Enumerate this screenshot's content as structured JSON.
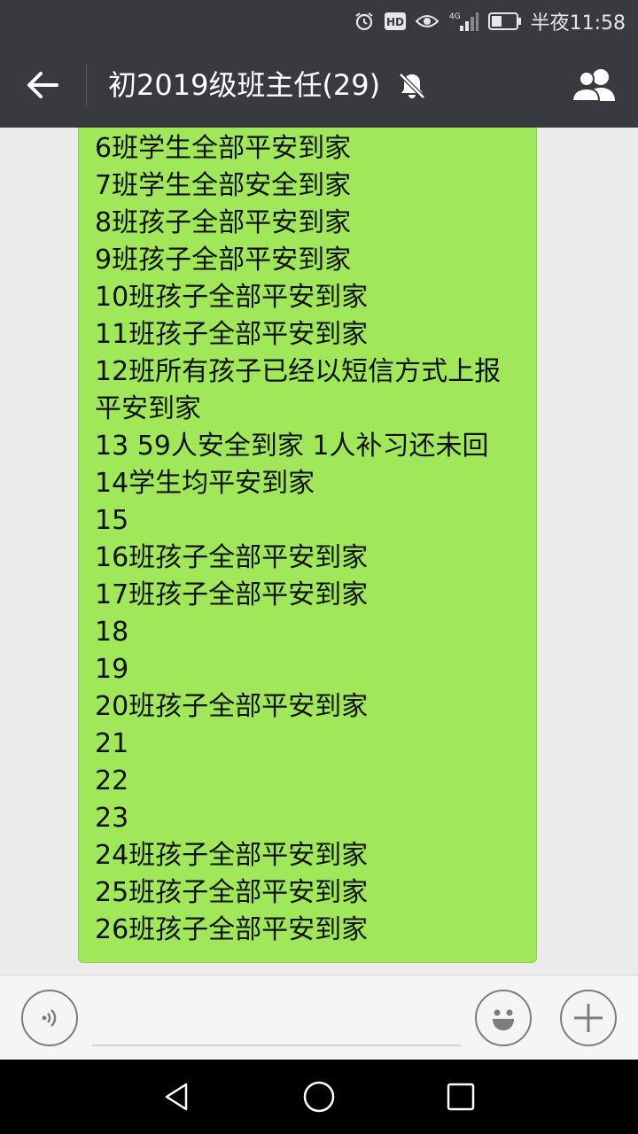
{
  "status_bar": {
    "time": "半夜11:58",
    "network": "4G",
    "icons": [
      "alarm-icon",
      "hd-icon",
      "eye-icon",
      "signal-icon",
      "battery-icon"
    ]
  },
  "header": {
    "title": "初2019级班主任(29)",
    "icons": [
      "back-arrow-icon",
      "mute-bell-icon",
      "group-members-icon"
    ]
  },
  "message": {
    "bubble_color": "#a0e75a",
    "lines": [
      "6班学生全部平安到家",
      "7班学生全部安全到家",
      "8班孩子全部平安到家",
      "9班孩子全部平安到家",
      "10班孩子全部平安到家",
      "11班孩子全部平安到家",
      "12班所有孩子已经以短信方式上报",
      "平安到家",
      "13 59人安全到家 1人补习还未回",
      "14学生均平安到家",
      "15",
      "16班孩子全部平安到家",
      "17班孩子全部平安到家",
      "18",
      "19",
      "20班孩子全部平安到家",
      "21",
      "22",
      "23",
      "24班孩子全部平安到家",
      "25班孩子全部平安到家",
      "26班孩子全部平安到家"
    ]
  },
  "input_bar": {
    "value": "",
    "icons": [
      "voice-icon",
      "emoji-icon",
      "plus-icon"
    ]
  },
  "nav_bar": {
    "icons": [
      "back-triangle-icon",
      "home-circle-icon",
      "recents-square-icon"
    ]
  },
  "colors": {
    "header_bg": "#393a3f",
    "chat_bg": "#ebebeb",
    "bubble": "#a0e75a"
  }
}
